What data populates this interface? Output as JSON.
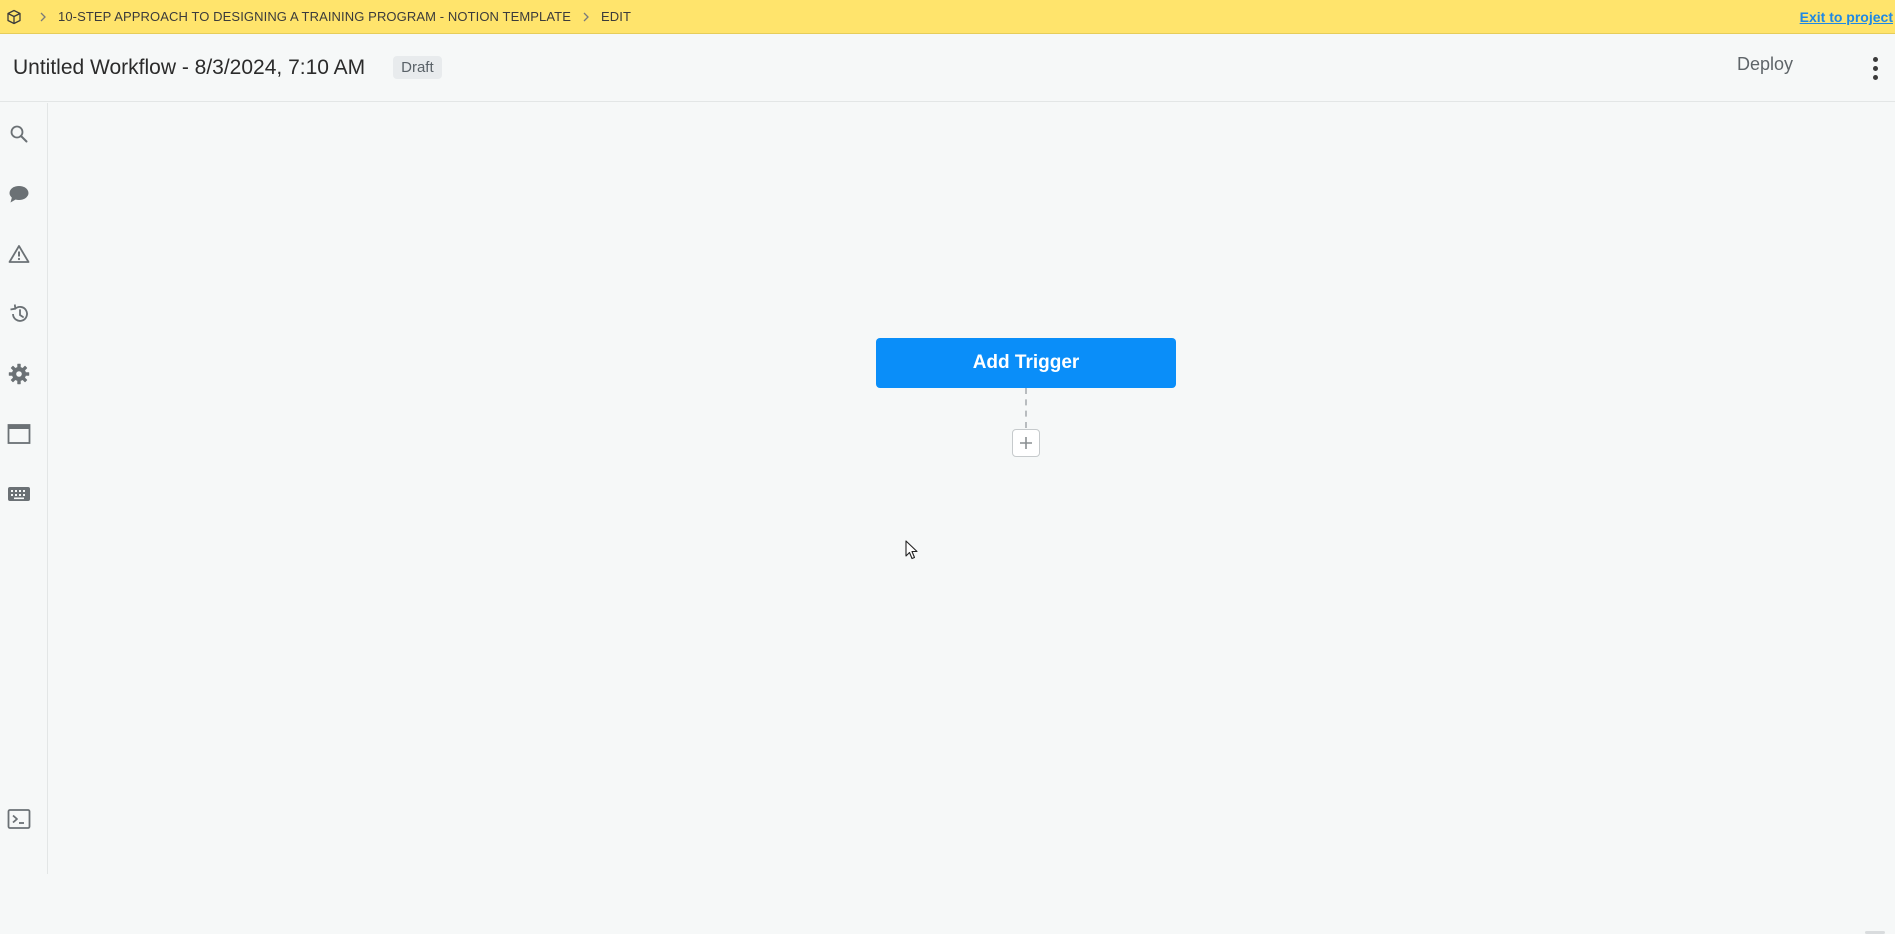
{
  "breadcrumb": {
    "logo_icon": "cube-icon",
    "project": "10-STEP APPROACH TO DESIGNING A TRAINING PROGRAM - NOTION TEMPLATE",
    "mode": "EDIT",
    "exit_label": "Exit to project"
  },
  "header": {
    "title": "Untitled Workflow - 8/3/2024, 7:10 AM",
    "status_badge": "Draft",
    "deploy_label": "Deploy"
  },
  "rail": {
    "items": [
      {
        "icon": "search-icon"
      },
      {
        "icon": "chat-icon"
      },
      {
        "icon": "warning-icon"
      },
      {
        "icon": "history-icon"
      },
      {
        "icon": "gear-icon"
      },
      {
        "icon": "window-icon"
      },
      {
        "icon": "keyboard-icon"
      },
      {
        "icon": "terminal-icon"
      }
    ]
  },
  "canvas": {
    "add_trigger_label": "Add Trigger"
  },
  "colors": {
    "topbar": "#ffe46c",
    "primary": "#0a8ef9",
    "link": "#1e88e5",
    "background": "#f6f8f8"
  }
}
